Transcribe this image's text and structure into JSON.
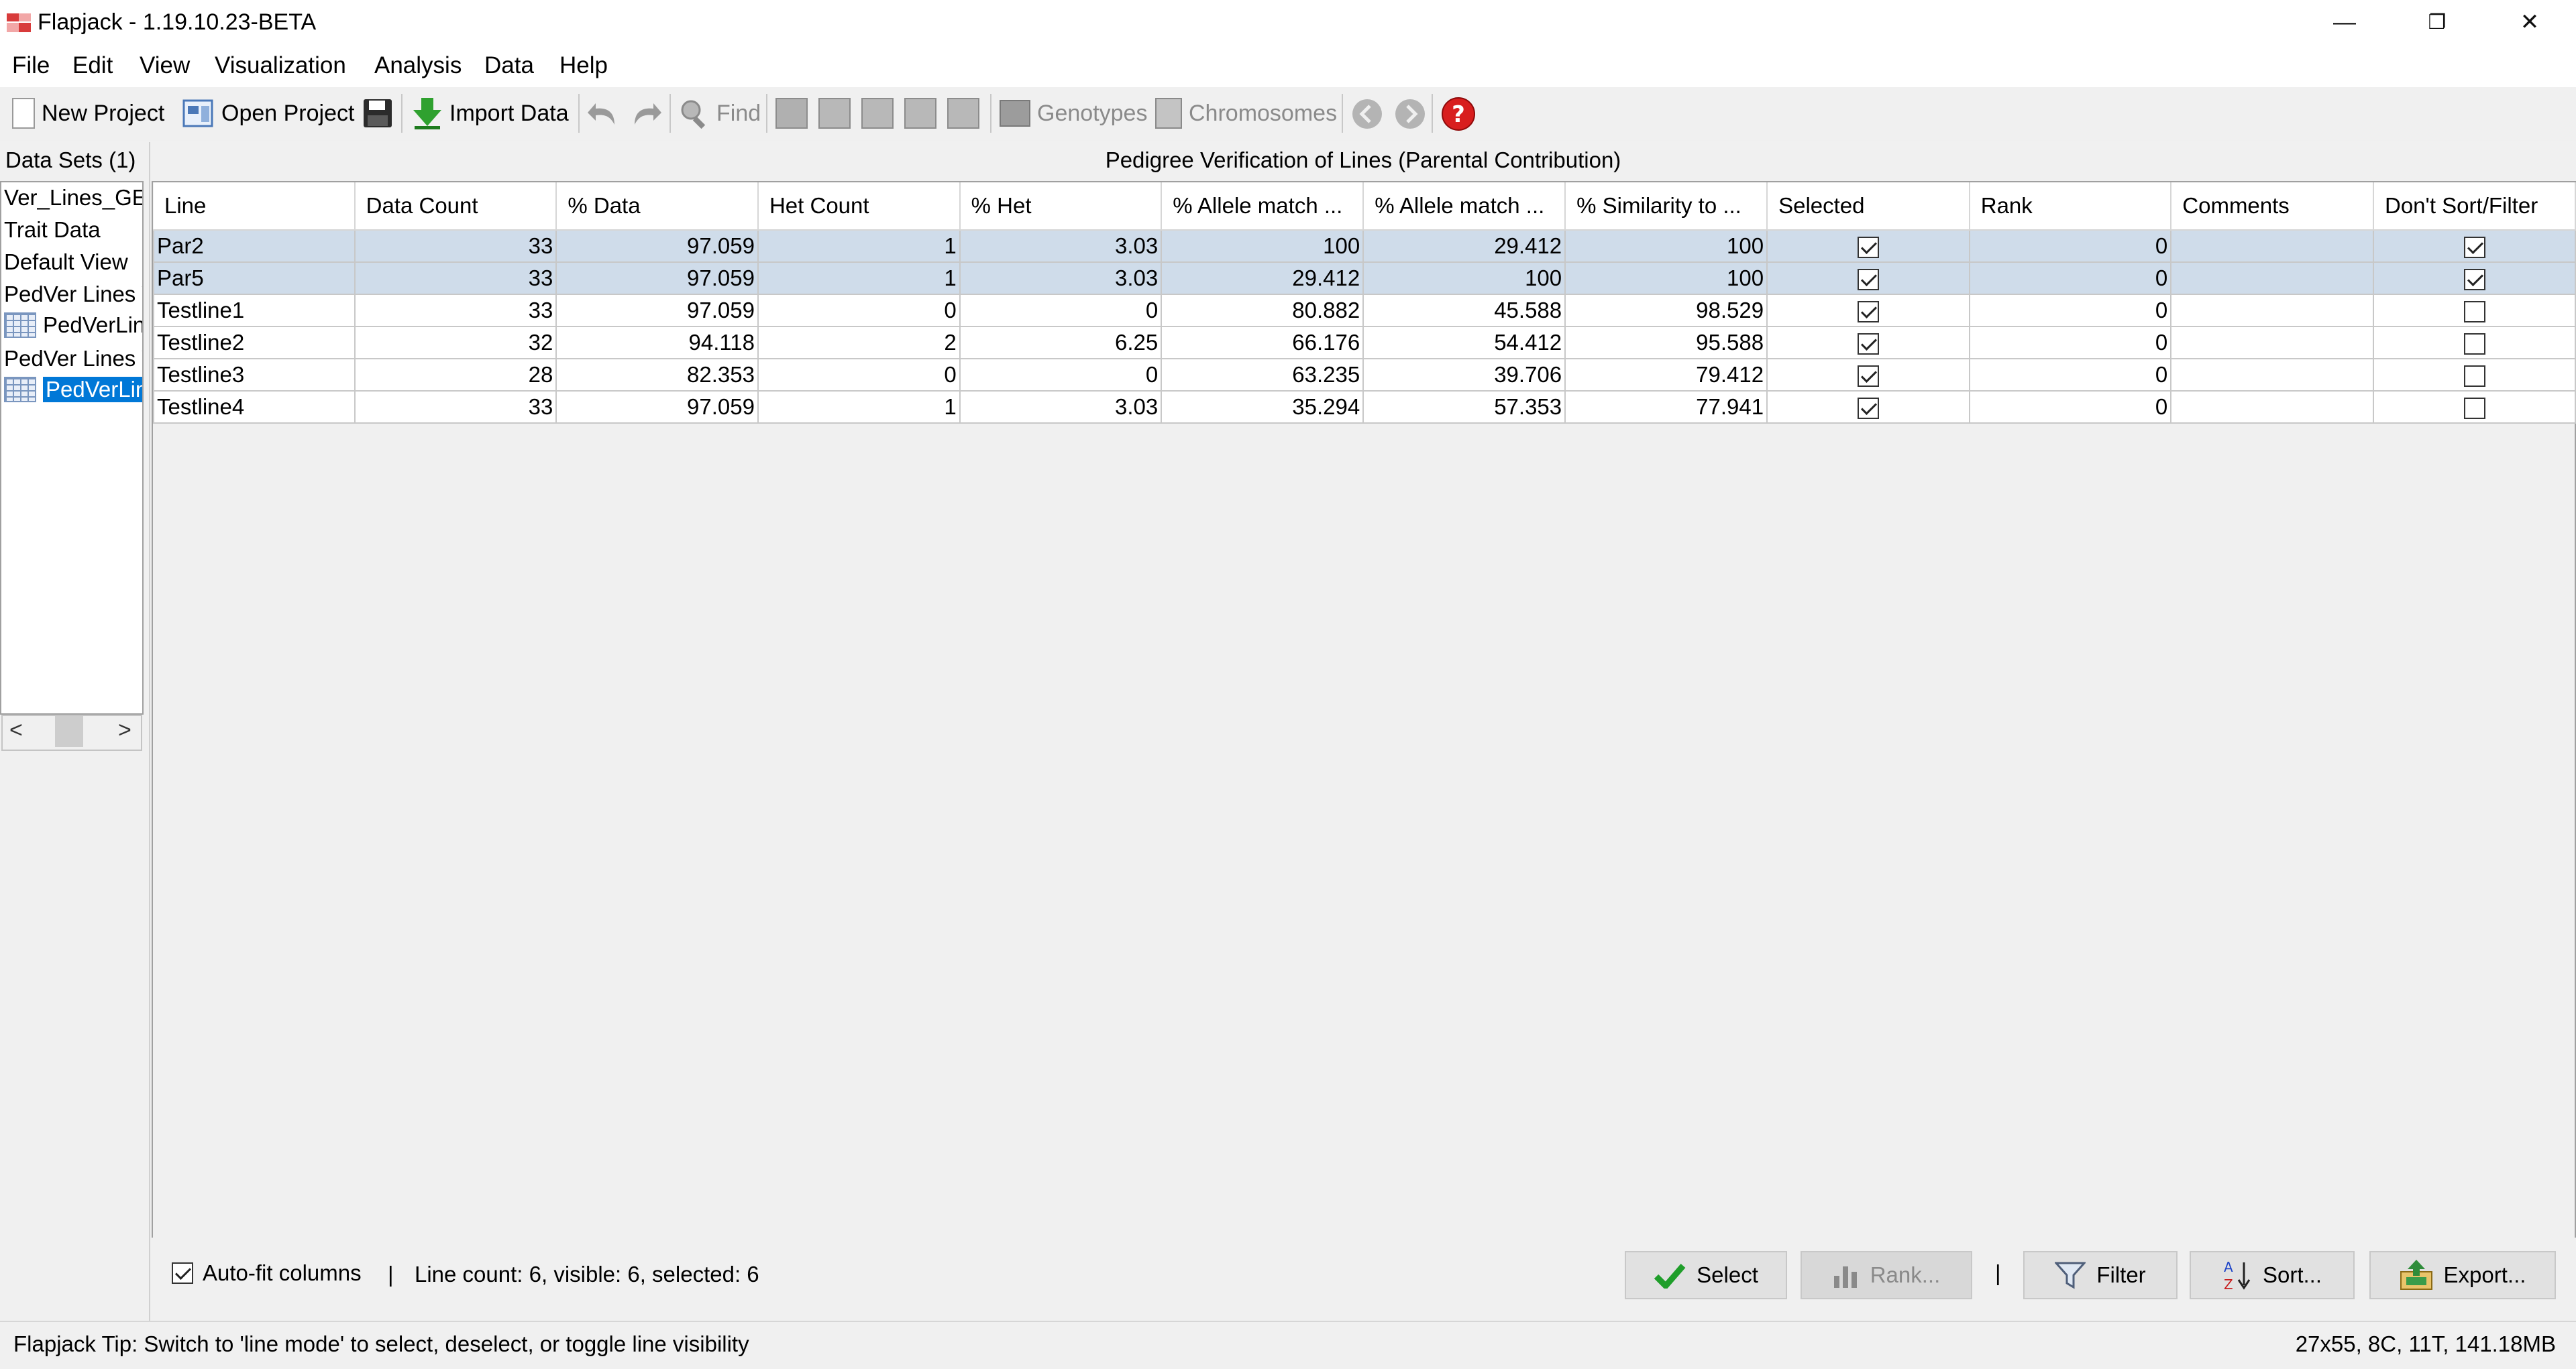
{
  "window": {
    "title": "Flapjack - 1.19.10.23-BETA",
    "controls": [
      "—",
      "❐",
      "✕"
    ]
  },
  "menu": [
    "File",
    "Edit",
    "View",
    "Visualization",
    "Analysis",
    "Data",
    "Help"
  ],
  "toolbar": {
    "new_project": "New Project",
    "open_project": "Open Project",
    "import_data": "Import Data",
    "find": "Find",
    "genotypes": "Genotypes",
    "chromosomes": "Chromosomes"
  },
  "sidebar": {
    "title": "Data Sets (1)",
    "items": [
      {
        "label": "Ver_Lines_GEI"
      },
      {
        "label": "Trait Data"
      },
      {
        "label": "Default View"
      },
      {
        "label": "PedVer Lines V"
      },
      {
        "label": "PedVerLin"
      },
      {
        "label": "PedVer Lines V"
      },
      {
        "label": "PedVerLin"
      }
    ],
    "scroll_left": "<",
    "scroll_right": ">"
  },
  "panel_title": "Pedigree Verification of Lines (Parental Contribution)",
  "table": {
    "columns": [
      "Line",
      "Data Count",
      "% Data",
      "Het Count",
      "% Het",
      "% Allele match ...",
      "% Allele match ...",
      "% Similarity to ...",
      "Selected",
      "Rank",
      "Comments",
      "Don't Sort/Filter"
    ],
    "rows": [
      {
        "line": "Par2",
        "data_count": "33",
        "pct_data": "97.059",
        "het_count": "1",
        "pct_het": "3.03",
        "allele1": "100",
        "allele2": "29.412",
        "similarity": "100",
        "selected": true,
        "rank": "0",
        "comments": "",
        "dont_sort": true
      },
      {
        "line": "Par5",
        "data_count": "33",
        "pct_data": "97.059",
        "het_count": "1",
        "pct_het": "3.03",
        "allele1": "29.412",
        "allele2": "100",
        "similarity": "100",
        "selected": true,
        "rank": "0",
        "comments": "",
        "dont_sort": true
      },
      {
        "line": "Testline1",
        "data_count": "33",
        "pct_data": "97.059",
        "het_count": "0",
        "pct_het": "0",
        "allele1": "80.882",
        "allele2": "45.588",
        "similarity": "98.529",
        "selected": true,
        "rank": "0",
        "comments": "",
        "dont_sort": false
      },
      {
        "line": "Testline2",
        "data_count": "32",
        "pct_data": "94.118",
        "het_count": "2",
        "pct_het": "6.25",
        "allele1": "66.176",
        "allele2": "54.412",
        "similarity": "95.588",
        "selected": true,
        "rank": "0",
        "comments": "",
        "dont_sort": false
      },
      {
        "line": "Testline3",
        "data_count": "28",
        "pct_data": "82.353",
        "het_count": "0",
        "pct_het": "0",
        "allele1": "63.235",
        "allele2": "39.706",
        "similarity": "79.412",
        "selected": true,
        "rank": "0",
        "comments": "",
        "dont_sort": false
      },
      {
        "line": "Testline4",
        "data_count": "33",
        "pct_data": "97.059",
        "het_count": "1",
        "pct_het": "3.03",
        "allele1": "35.294",
        "allele2": "57.353",
        "similarity": "77.941",
        "selected": true,
        "rank": "0",
        "comments": "",
        "dont_sort": false
      }
    ]
  },
  "bottom": {
    "autofit_label": "Auto-fit columns",
    "autofit_checked": true,
    "separator": "|",
    "count_text": "Line count: 6, visible: 6, selected: 6",
    "select": "Select",
    "rank": "Rank...",
    "filter": "Filter",
    "sort": "Sort...",
    "export": "Export..."
  },
  "status": {
    "tip": "Flapjack Tip:  Switch to 'line mode' to select, deselect, or toggle line visibility",
    "memory": "27x55, 8C, 11T, 141.18MB"
  }
}
